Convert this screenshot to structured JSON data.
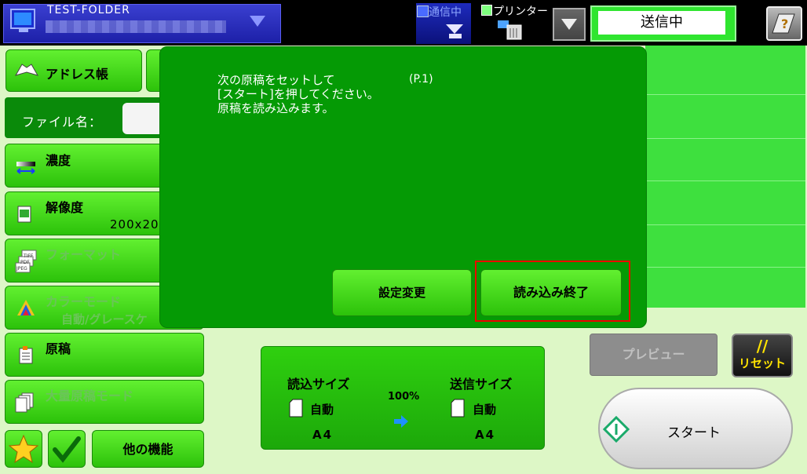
{
  "topbar": {
    "destination_title": "TEST-FOLDER",
    "comm_label": "通信中",
    "printer_label": "プリンター",
    "status_text": "送信中"
  },
  "sidebar": {
    "address_book": "アドレス帳",
    "file_name_label": "ファイル名：",
    "density": "濃度",
    "resolution": "解像度",
    "resolution_value": "200x20",
    "format": "フォーマット",
    "format_icon_text": [
      "TIFF",
      "PDF",
      "JPEG"
    ],
    "color_mode": "カラーモード",
    "color_mode_value": "自動/グレースケ",
    "original": "原稿",
    "bulk_mode": "大量原稿モード",
    "other_functions": "他の機能"
  },
  "modal": {
    "message": "次の原稿をセットして\n[スタート]を押してください。\n原稿を読み込みます。",
    "page_indicator": "(P.1)",
    "settings_button": "設定変更",
    "done_button": "読み込み終了"
  },
  "size_panel": {
    "scan_size_label": "読込サイズ",
    "send_size_label": "送信サイズ",
    "ratio": "100%",
    "scan_auto": "自動",
    "send_auto": "自動",
    "scan_paper": "A4",
    "send_paper": "A4"
  },
  "actions": {
    "preview": "プレビュー",
    "reset_symbol": "//",
    "reset": "リセット",
    "start": "スタート"
  },
  "colors": {
    "button_green": "#3fdc1a",
    "modal_green": "#059a05",
    "status_green": "#2fe52f",
    "highlight_red": "#e00000"
  }
}
